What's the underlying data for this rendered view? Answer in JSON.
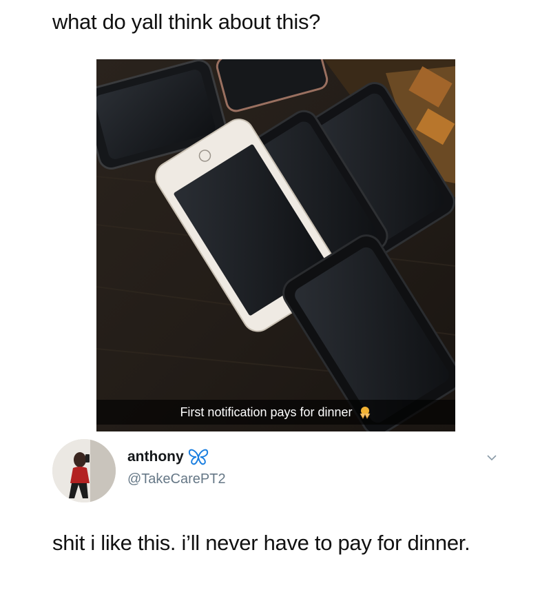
{
  "post": {
    "question": "what do yall think about this?"
  },
  "photo": {
    "caption": "First notification pays for dinner",
    "caption_emoji": "pleading-hands-emoji"
  },
  "tweet": {
    "display_name": "anthony",
    "name_badge_icon": "blue-butterfly-icon",
    "handle": "@TakeCarePT2",
    "text": "shit i like this. i’ll never have to pay for dinner.",
    "menu_icon": "chevron-down-icon"
  },
  "colors": {
    "handle": "#657786",
    "butterfly": "#1b7fe0",
    "text": "#111111"
  }
}
